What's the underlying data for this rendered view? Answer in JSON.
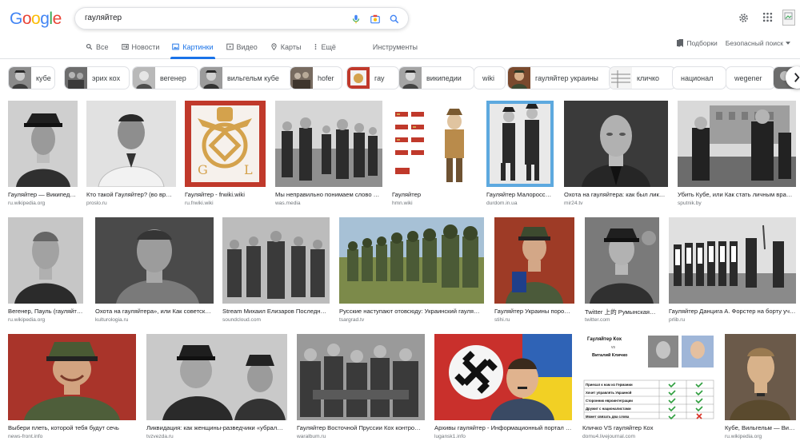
{
  "search": {
    "query": "гауляйтер"
  },
  "logo": {
    "letters": [
      "G",
      "o",
      "o",
      "g",
      "l",
      "e"
    ],
    "colors": [
      "#4285f4",
      "#ea4335",
      "#fbbc05",
      "#4285f4",
      "#34a853",
      "#ea4335"
    ]
  },
  "tabs": [
    {
      "label": "Все",
      "icon": "search-icon"
    },
    {
      "label": "Новости",
      "icon": "news-icon"
    },
    {
      "label": "Картинки",
      "icon": "image-icon",
      "active": true
    },
    {
      "label": "Видео",
      "icon": "video-icon"
    },
    {
      "label": "Карты",
      "icon": "map-pin-icon"
    },
    {
      "label": "Ещё",
      "icon": "more-vert-icon"
    }
  ],
  "tools_label": "Инструменты",
  "right_links": {
    "collections": "Подборки",
    "safesearch": "Безопасный поиск"
  },
  "chips": [
    {
      "label": "кубе",
      "thumb": true
    },
    {
      "label": "эрих кох",
      "thumb": true
    },
    {
      "label": "вегенер",
      "thumb": true
    },
    {
      "label": "вильгельм кубе",
      "thumb": true
    },
    {
      "label": "hofer",
      "thumb": true
    },
    {
      "label": "гау",
      "thumb": true
    },
    {
      "label": "википедии",
      "thumb": true
    },
    {
      "label": "wiki",
      "thumb": false
    },
    {
      "label": "гауляйтер украины",
      "thumb": true
    },
    {
      "label": "кличко",
      "thumb": true
    },
    {
      "label": "национал",
      "thumb": false
    },
    {
      "label": "wegener",
      "thumb": false
    },
    {
      "label": "",
      "thumb": true
    }
  ],
  "results": [
    {
      "caption": "Гауляйтер — Википед…",
      "source": "ru.wikipedia.org"
    },
    {
      "caption": "Кто такой Гауляйтер? (во вр…",
      "source": "proslo.ru"
    },
    {
      "caption": "Гауляйтер - frwiki.wiki",
      "source": "ru.frwiki.wiki"
    },
    {
      "caption": "Мы неправильно понимаем слово …",
      "source": "was.media"
    },
    {
      "caption": "Гауляйтер",
      "source": "hmn.wiki"
    },
    {
      "caption": "Гауляйтер Малоросси…",
      "source": "durdom.in.ua"
    },
    {
      "caption": "Охота на гауляйтера: как был лик…",
      "source": "mir24.tv"
    },
    {
      "caption": "Убить Кубе, или Как стать личным вра…",
      "source": "sputnik.by"
    },
    {
      "caption": "Вегенер, Пауль (гауляйт…",
      "source": "ru.wikipedia.org"
    },
    {
      "caption": "Охота на гауляйтера», или Как советск…",
      "source": "kulturologia.ru"
    },
    {
      "caption": "Stream Михаил Елизаров Последни…",
      "source": "soundcloud.com"
    },
    {
      "caption": "Русские наступают отовсюду: Украинский гауля…",
      "source": "tsargrad.tv"
    },
    {
      "caption": "Гауляйтер Украины поро…",
      "source": "stihi.ru"
    },
    {
      "caption": "Twitter 上的 Румынская…",
      "source": "twitter.com"
    },
    {
      "caption": "Гауляйтер Данцига А. Форстер на борту уч…",
      "source": "prlib.ru"
    },
    {
      "caption": "Выбери плеть, которой тебя будут сечь",
      "source": "news-front.info"
    },
    {
      "caption": "Ликвидация: как женщины-разведчики «убрал…",
      "source": "tvzvezda.ru"
    },
    {
      "caption": "Гауляйтер Восточной Пруссии Кох контро…",
      "source": "waralbum.ru"
    },
    {
      "caption": "Архивы гауляйтер - Информационный портал …",
      "source": "lugansk1.info"
    },
    {
      "caption": "Кличко VS гауляйтер Кох",
      "source": "domu4.livejournal.com"
    },
    {
      "caption": "Кубе, Вильгельм — Ви…",
      "source": "ru.wikipedia.org"
    }
  ],
  "embedded_texts": {
    "flag_letters": [
      "G",
      "L"
    ],
    "koch_title": "Гауляйтер Кох",
    "koch_vs": "vs",
    "koch_subtitle": "Виталий Кличко",
    "koch_rows": [
      "Приехал к нам из Германии",
      "Хочет управлять Украиной",
      "Сторонник евроинтеграции",
      "Дружит с националистами",
      "Может связать два слова"
    ]
  },
  "colors": {
    "accent": "#1a73e8",
    "flag_red": "#c0392b",
    "gold": "#d4a24c"
  }
}
